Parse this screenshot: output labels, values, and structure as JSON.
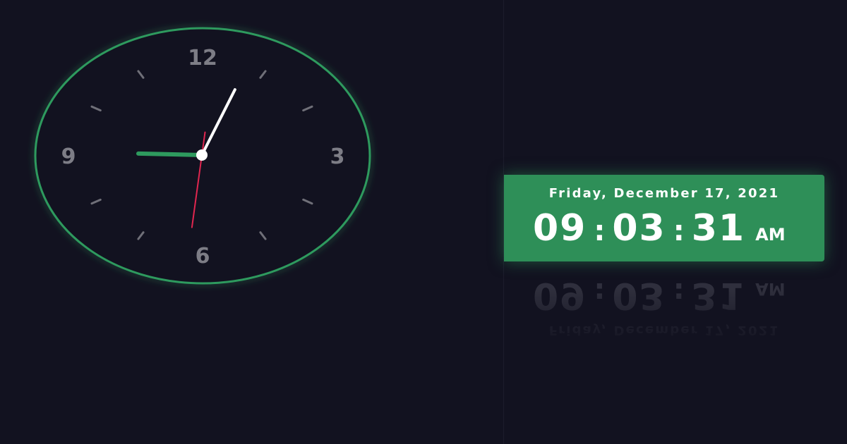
{
  "analog_clock": {
    "numerals": {
      "twelve": "12",
      "three": "3",
      "six": "6",
      "nine": "9"
    },
    "time": {
      "hour": 9,
      "minute": 3,
      "second": 31
    },
    "colors": {
      "rim": "#2e9a5e",
      "hour_hand": "#2e9a5e",
      "minute_hand": "#ffffff",
      "second_hand": "#e0264f",
      "tick": "#6f6f78",
      "numeral": "#7d7d86",
      "center_dot": "#ffffff",
      "face": "#121220"
    }
  },
  "digital_clock": {
    "date": "Friday, December 17, 2021",
    "hours": "09",
    "minutes": "03",
    "seconds": "31",
    "separator": ":",
    "ampm": "AM",
    "colors": {
      "panel": "#2e8f58",
      "text": "#ffffff"
    }
  }
}
